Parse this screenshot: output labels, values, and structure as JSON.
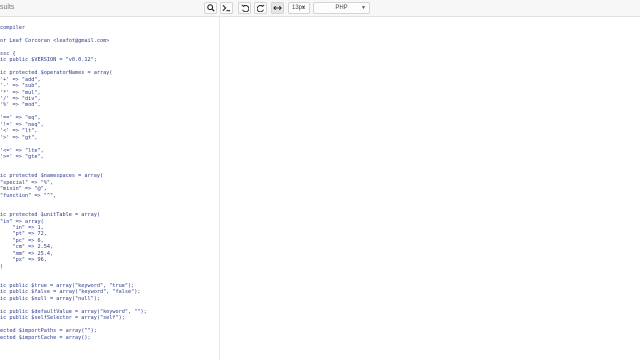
{
  "window": {
    "title": "sults"
  },
  "toolbar": {
    "search_icon": "search-icon",
    "console_icon": "terminal-icon",
    "undo_icon": "undo-icon",
    "redo_icon": "redo-icon",
    "wrap_icon": "horizontal-arrows-icon",
    "font_size": "13px",
    "language": "PHP"
  },
  "editor": {
    "lines": [
      "compiler",
      "",
      "or Leaf Corcoran <leafot@gmail.com>",
      "",
      "ssc {",
      "ic public $VERSION = \"v0.0.12\";",
      "",
      "ic protected $operatorNames = array(",
      "'+' => \"add\",",
      "'-' => \"sub\",",
      "'*' => \"mul\",",
      "'/' => \"div\",",
      "'%' => \"mod\",",
      "",
      "'==' => \"eq\",",
      "'!=' => \"neq\",",
      "'<' => \"lt\",",
      "'>' => \"gt\",",
      "",
      "'<=' => \"lte\",",
      "'>=' => \"gte\",",
      "",
      "",
      "ic protected $namespaces = array(",
      "\"special\" => \"%\",",
      "\"mixin\" => \"@\",",
      "\"function\" => \"^\",",
      "",
      "",
      "ic protected $unitTable = array(",
      "\"in\" => array(",
      "    \"in\" => 1,",
      "    \"pt\" => 72,",
      "    \"pc\" => 6,",
      "    \"cm\" => 2.54,",
      "    \"mm\" => 25.4,",
      "    \"px\" => 96,",
      ")",
      "",
      "",
      "ic public $true = array(\"keyword\", \"true\");",
      "ic public $false = array(\"keyword\", \"false\");",
      "ic public $null = array(\"null\");",
      "",
      "ic public $defaultValue = array(\"keyword\", \"\");",
      "ic public $selfSelector = array(\"self\");",
      "",
      "ected $importPaths = array(\"\");",
      "ected $importCache = array();"
    ]
  }
}
